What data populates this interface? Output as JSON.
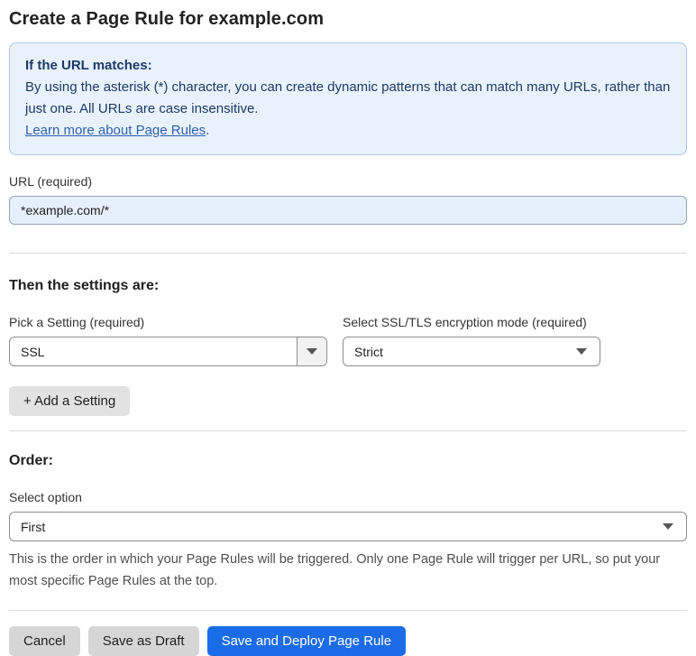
{
  "page": {
    "title": "Create a Page Rule for example.com"
  },
  "info_box": {
    "heading": "If the URL matches:",
    "body": "By using the asterisk (*) character, you can create dynamic patterns that can match many URLs, rather than just one. All URLs are case insensitive.",
    "link": "Learn more about Page Rules",
    "link_suffix": "."
  },
  "url_field": {
    "label": "URL (required)",
    "value": "*example.com/*"
  },
  "settings": {
    "heading": "Then the settings are:",
    "setting_select": {
      "label": "Pick a Setting (required)",
      "value": "SSL"
    },
    "mode_select": {
      "label": "Select SSL/TLS encryption mode (required)",
      "value": "Strict"
    },
    "add_button_label": "+ Add a Setting"
  },
  "order": {
    "heading": "Order:",
    "select_label": "Select option",
    "value": "First",
    "help": "This is the order in which your Page Rules will be triggered. Only one Page Rule will trigger per URL, so put your most specific Page Rules at the top."
  },
  "actions": {
    "cancel_label": "Cancel",
    "save_draft_label": "Save as Draft",
    "save_deploy_label": "Save and Deploy Page Rule"
  },
  "colors": {
    "accent_blue": "#1a6ce8",
    "info_background": "#e9f2fc",
    "info_border": "#a9c9ea",
    "info_text": "#1d3a66",
    "link_blue": "#2c5fae",
    "input_fill": "#e6effc"
  }
}
